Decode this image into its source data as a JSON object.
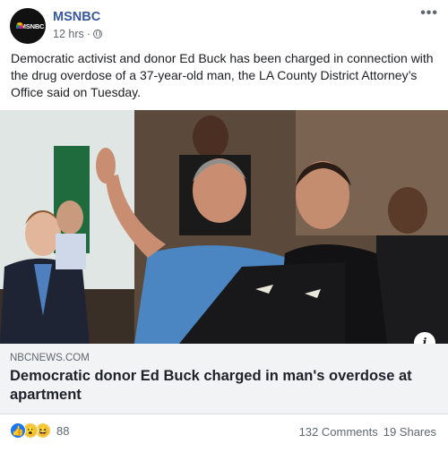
{
  "page": {
    "name": "MSNBC",
    "avatar_text": "MSNBC",
    "time": "12 hrs",
    "privacy_icon": "globe-icon"
  },
  "post": {
    "caption": "Democratic activist and donor Ed Buck has been charged in connection with the drug overdose of a 37-year-old man, the LA County District Attorney’s Office said on Tuesday."
  },
  "link": {
    "domain": "NBCNEWS.COM",
    "title": "Democratic donor Ed Buck charged in man's overdose at apartment"
  },
  "reactions": {
    "icons": [
      "like-icon",
      "wow-icon",
      "haha-icon"
    ],
    "count": "88"
  },
  "stats": {
    "comments": "132 Comments",
    "shares": "19 Shares"
  },
  "colors": {
    "page_name": "#385898",
    "link_bg": "#f2f3f5",
    "like": "#1877f2"
  }
}
